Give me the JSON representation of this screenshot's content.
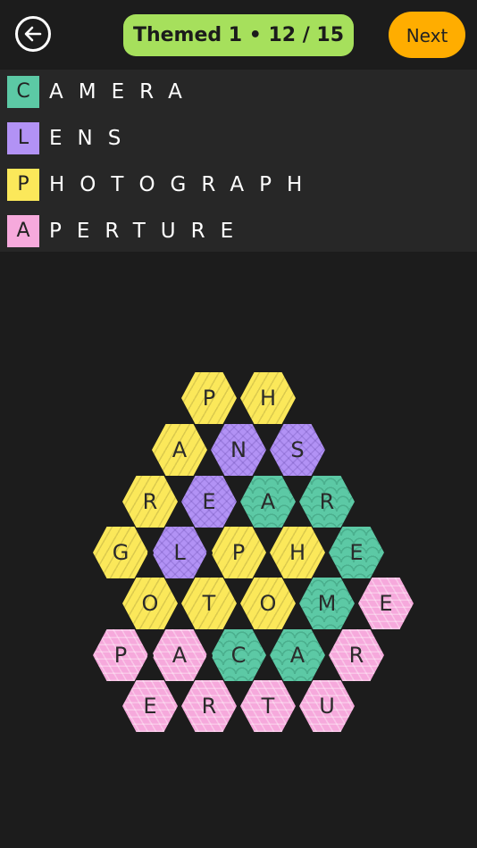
{
  "header": {
    "title": "Themed 1 • 12 / 15",
    "next_label": "Next"
  },
  "words": [
    {
      "initial": "C",
      "rest": "AMERA",
      "color": "#5cc9a5"
    },
    {
      "initial": "L",
      "rest": "ENS",
      "color": "#b292f5"
    },
    {
      "initial": "P",
      "rest": "HOTOGRAPH",
      "color": "#fbe85a"
    },
    {
      "initial": "A",
      "rest": "PERTURE",
      "color": "#f6a9dc"
    }
  ],
  "grid": {
    "rows": [
      [
        {
          "l": "P",
          "c": "yellow"
        },
        {
          "l": "H",
          "c": "yellow"
        }
      ],
      [
        {
          "l": "A",
          "c": "yellow"
        },
        {
          "l": "N",
          "c": "purple"
        },
        {
          "l": "S",
          "c": "purple"
        }
      ],
      [
        {
          "l": "R",
          "c": "yellow"
        },
        {
          "l": "E",
          "c": "purple"
        },
        {
          "l": "A",
          "c": "teal"
        },
        {
          "l": "R",
          "c": "teal"
        }
      ],
      [
        {
          "l": "G",
          "c": "yellow"
        },
        {
          "l": "L",
          "c": "purple"
        },
        {
          "l": "P",
          "c": "yellow"
        },
        {
          "l": "H",
          "c": "yellow"
        },
        {
          "l": "E",
          "c": "teal"
        }
      ],
      [
        {
          "l": "O",
          "c": "yellow"
        },
        {
          "l": "T",
          "c": "yellow"
        },
        {
          "l": "O",
          "c": "yellow"
        },
        {
          "l": "M",
          "c": "teal"
        },
        {
          "l": "E",
          "c": "pink"
        }
      ],
      [
        {
          "l": "P",
          "c": "pink"
        },
        {
          "l": "A",
          "c": "pink"
        },
        {
          "l": "C",
          "c": "teal"
        },
        {
          "l": "A",
          "c": "teal"
        },
        {
          "l": "R",
          "c": "pink"
        }
      ],
      [
        {
          "l": "E",
          "c": "pink"
        },
        {
          "l": "R",
          "c": "pink"
        },
        {
          "l": "T",
          "c": "pink"
        },
        {
          "l": "U",
          "c": "pink"
        }
      ]
    ]
  },
  "colors": {
    "background": "#1c1c1c",
    "title_pill": "#a6e05c",
    "next_button": "#ffad00"
  }
}
